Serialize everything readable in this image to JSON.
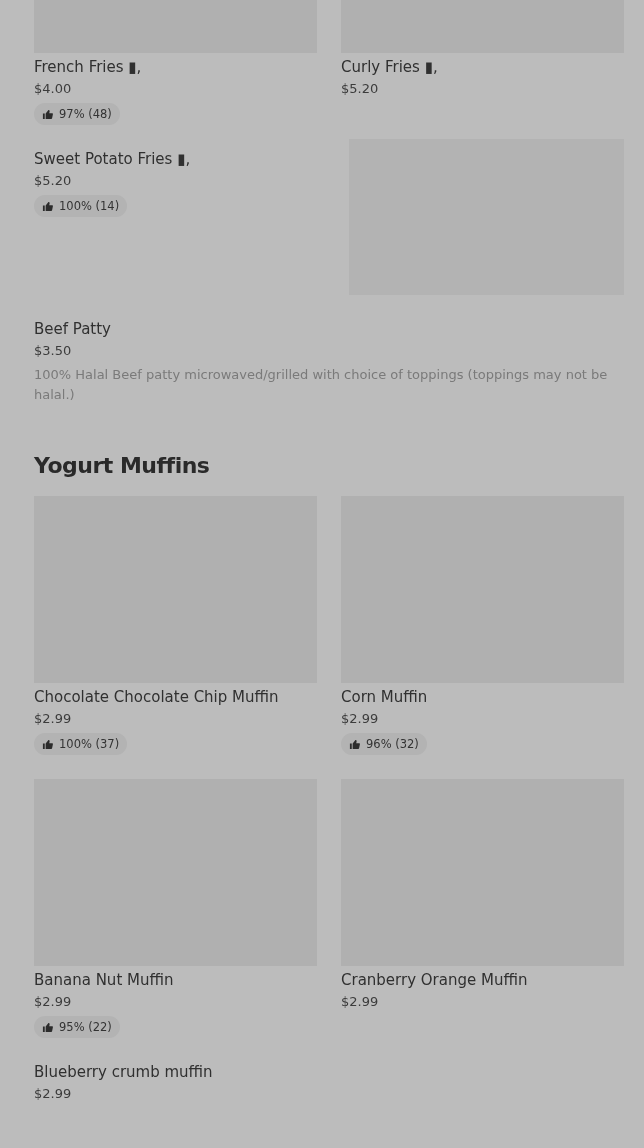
{
  "blocks": [
    {
      "kind": "grid",
      "items": [
        {
          "name": "French Fries ▮,",
          "price": "$4.00",
          "rating": "97% (48)"
        },
        {
          "name": "Curly Fries ▮,",
          "price": "$5.20"
        }
      ]
    },
    {
      "kind": "row",
      "name": "Sweet Potato Fries ▮,",
      "price": "$5.20",
      "rating": "100% (14)",
      "image": true
    },
    {
      "kind": "row",
      "name": "Beef Patty",
      "price": "$3.50",
      "description": "100% Halal Beef patty microwaved/grilled with choice of toppings (toppings may not be halal.)",
      "image": false
    },
    {
      "kind": "heading",
      "text": "Yogurt Muffins"
    },
    {
      "kind": "grid",
      "items": [
        {
          "name": "Chocolate Chocolate Chip Muffin",
          "price": "$2.99",
          "rating": "100% (37)"
        },
        {
          "name": "Corn Muffin",
          "price": "$2.99",
          "rating": "96% (32)"
        }
      ]
    },
    {
      "kind": "grid",
      "items": [
        {
          "name": "Banana Nut Muffin",
          "price": "$2.99",
          "rating": "95% (22)"
        },
        {
          "name": "Cranberry Orange Muffin",
          "price": "$2.99"
        }
      ]
    },
    {
      "kind": "row",
      "name": "Blueberry crumb muffin",
      "price": "$2.99",
      "image": false
    }
  ]
}
